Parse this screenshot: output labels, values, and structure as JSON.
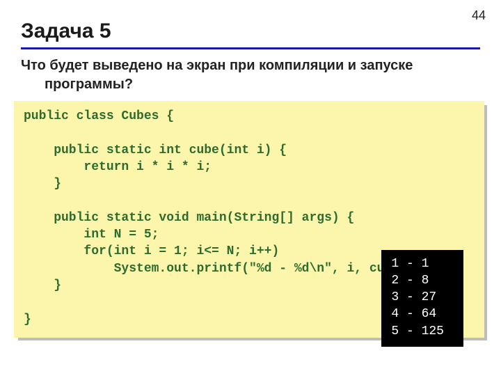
{
  "page_number": "44",
  "title": "Задача 5",
  "question_line1": "Что будет выведено на экран при компиляции и запуске",
  "question_line2": "программы?",
  "code": "public class Cubes {\n\n    public static int cube(int i) {\n        return i * i * i;\n    }\n\n    public static void main(String[] args) {\n        int N = 5;\n        for(int i = 1; i<= N; i++)\n            System.out.printf(\"%d - %d\\n\", i, cube(i));\n    }\n\n}",
  "output": "1 - 1\n2 - 8\n3 - 27\n4 - 64\n5 - 125"
}
